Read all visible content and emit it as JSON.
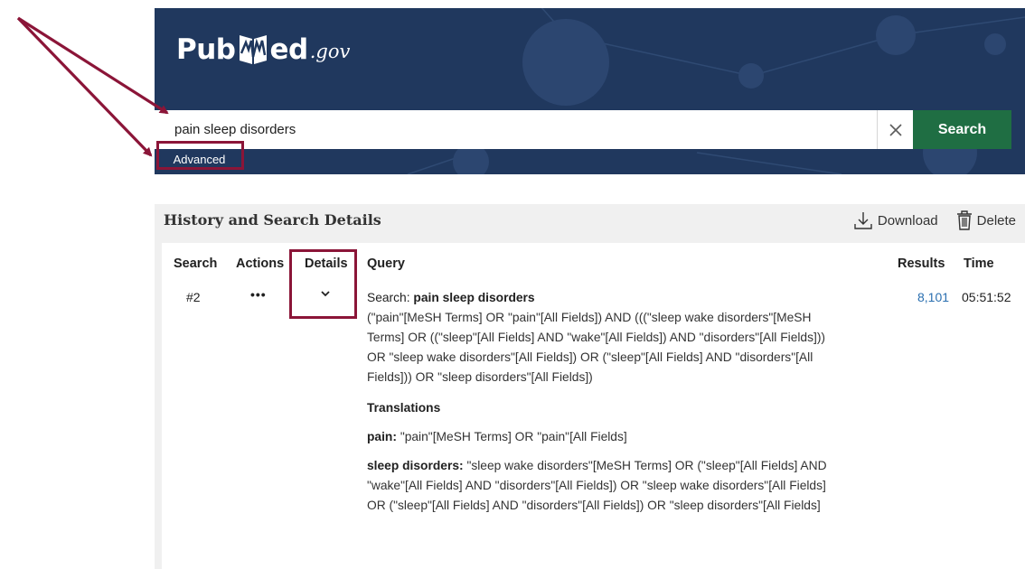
{
  "header": {
    "logo": {
      "part1": "Pub",
      "part2": "ed",
      "suffix": ".gov"
    },
    "search": {
      "value": "pain sleep disorders",
      "button_label": "Search"
    },
    "advanced_label": "Advanced",
    "colors": {
      "bg": "#20385e",
      "search_button": "#1f6e43"
    }
  },
  "history": {
    "title": "History and Search Details",
    "download_label": "Download",
    "delete_label": "Delete",
    "columns": {
      "search": "Search",
      "actions": "Actions",
      "details": "Details",
      "query": "Query",
      "results": "Results",
      "time": "Time"
    },
    "rows": [
      {
        "search": "#2",
        "actions": "•••",
        "details_icon": "chevron-down-icon",
        "query_prefix": "Search:",
        "query_term": "pain sleep disorders",
        "details": "(\"pain\"[MeSH Terms] OR \"pain\"[All Fields]) AND (((\"sleep wake disorders\"[MeSH Terms] OR ((\"sleep\"[All Fields] AND \"wake\"[All Fields]) AND \"disorders\"[All Fields])) OR \"sleep wake disorders\"[All Fields]) OR (\"sleep\"[All Fields] AND \"disorders\"[All Fields])) OR \"sleep disorders\"[All Fields])",
        "translations_heading": "Translations",
        "translations": [
          {
            "term": "pain:",
            "text": "\"pain\"[MeSH Terms] OR \"pain\"[All Fields]"
          },
          {
            "term": "sleep disorders:",
            "text": "\"sleep wake disorders\"[MeSH Terms] OR (\"sleep\"[All Fields] AND \"wake\"[All Fields] AND \"disorders\"[All Fields]) OR \"sleep wake disorders\"[All Fields] OR (\"sleep\"[All Fields] AND \"disorders\"[All Fields]) OR \"sleep disorders\"[All Fields]"
          }
        ],
        "results": "8,101",
        "time": "05:51:52"
      }
    ]
  },
  "annotation_color": "#8b1538"
}
